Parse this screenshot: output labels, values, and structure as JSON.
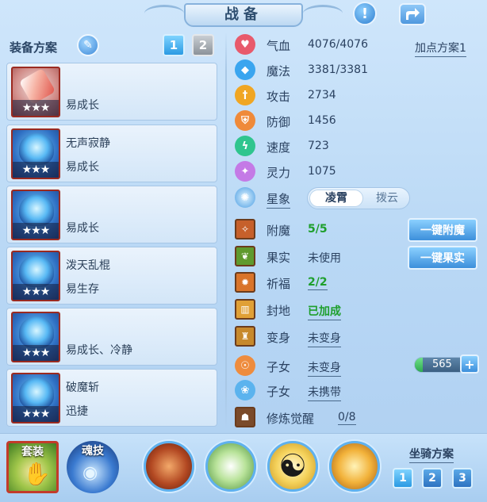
{
  "window": {
    "title": "战备",
    "alert_icon": "exclamation-icon",
    "share_icon": "share-icon"
  },
  "left": {
    "section_label": "装备方案",
    "edit_icon": "pencil-icon",
    "pages": [
      "1",
      "2"
    ],
    "active_page": "1",
    "equipment": [
      {
        "name": "",
        "trait": "易成长",
        "stars": "★★★",
        "icon": "popsicle-icon"
      },
      {
        "name": "无声寂静",
        "trait": "易成长",
        "stars": "★★★",
        "icon": "blue-helmet-icon"
      },
      {
        "name": "",
        "trait": "易成长",
        "stars": "★★★",
        "icon": "blue-armor-icon"
      },
      {
        "name": "泼天乱棍",
        "trait": "易生存",
        "stars": "★★★",
        "icon": "blue-boots-icon"
      },
      {
        "name": "",
        "trait": "易成长、冷静",
        "stars": "★★★",
        "icon": "blue-crown-icon"
      },
      {
        "name": "破魔斩",
        "trait": "迅捷",
        "stars": "★★★",
        "icon": "blue-wings-icon"
      }
    ]
  },
  "stats": {
    "plan_link": "加点方案1",
    "rows": [
      {
        "label": "气血",
        "value": "4076/4076",
        "icon": "heart-icon",
        "color": "#e85a6c"
      },
      {
        "label": "魔法",
        "value": "3381/3381",
        "icon": "diamond-icon",
        "color": "#3aa5ef"
      },
      {
        "label": "攻击",
        "value": "2734",
        "icon": "sword-icon",
        "color": "#f0a623"
      },
      {
        "label": "防御",
        "value": "1456",
        "icon": "shield-icon",
        "color": "#ef8a3a"
      },
      {
        "label": "速度",
        "value": "723",
        "icon": "lightning-icon",
        "color": "#2fc58e"
      },
      {
        "label": "灵力",
        "value": "1075",
        "icon": "sparkle-icon",
        "color": "#c47ae6"
      }
    ],
    "star_label": "星象",
    "star_options": [
      "凌霄",
      "拨云"
    ],
    "star_selected": "凌霄"
  },
  "buffs": {
    "rows": [
      {
        "label": "附魔",
        "value": "5/5",
        "icon": "enchant-icon",
        "value_color": "green"
      },
      {
        "label": "果实",
        "value": "未使用",
        "icon": "fruit-icon",
        "value_color": "dark"
      },
      {
        "label": "祈福",
        "value": "2/2",
        "icon": "blessing-icon",
        "value_color": "green"
      },
      {
        "label": "封地",
        "value": "已加成",
        "icon": "fief-icon",
        "value_color": "green"
      },
      {
        "label": "变身",
        "value": "未变身",
        "icon": "transform-icon",
        "value_color": "dark"
      },
      {
        "label": "子女",
        "value": "未变身",
        "icon": "child-icon",
        "value_color": "dark"
      },
      {
        "label": "子女",
        "value": "未携带",
        "icon": "paw-icon",
        "value_color": "dark"
      },
      {
        "label": "修炼觉醒",
        "value": "0/8",
        "icon": "cultivation-icon",
        "value_color": "dark"
      }
    ],
    "enchant_button": "一键附魔",
    "fruit_button": "一键果实",
    "coin_value": "565",
    "coin_fill_fraction": 0.12,
    "plus_label": "+"
  },
  "bottom": {
    "tiles": [
      {
        "label": "套装",
        "icon": "golden-hand-icon"
      },
      {
        "label": "魂技",
        "icon": "dragon-orb-icon"
      }
    ],
    "orbs": [
      "beast-head-icon",
      "sword-slash-icon",
      "yin-yang-icon",
      "gold-wing-icon"
    ],
    "mount_label": "坐骑方案",
    "mount_buttons": [
      "1",
      "2",
      "3"
    ],
    "mount_active": "1"
  }
}
